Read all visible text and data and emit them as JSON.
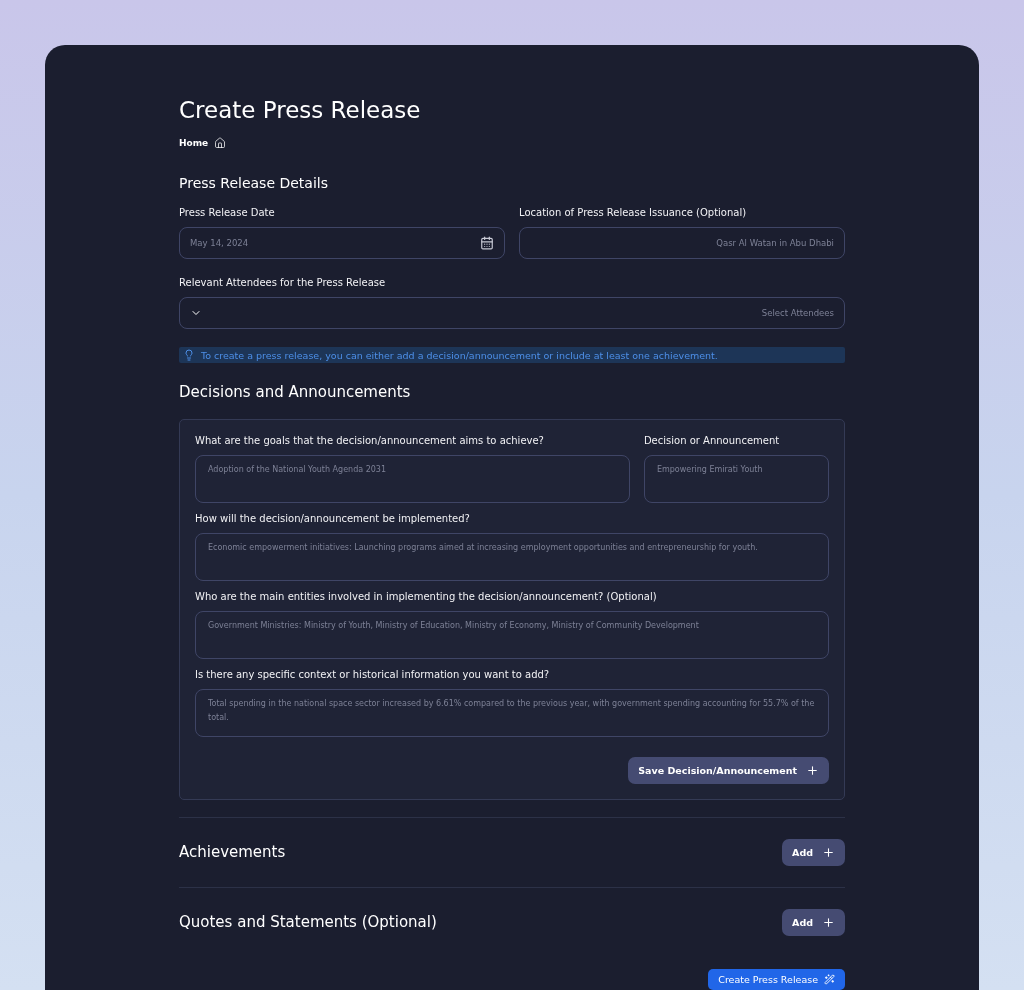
{
  "title": "Create Press Release",
  "breadcrumb": {
    "label": "Home"
  },
  "details": {
    "heading": "Press Release Details",
    "fields": [
      {
        "label": "Press Release Date",
        "placeholder": "May 14, 2024",
        "kind": "date"
      },
      {
        "label": "Location of Press Release Issuance (Optional)",
        "placeholder": "Qasr Al Watan in Abu Dhabi",
        "kind": "text"
      }
    ],
    "attendees": {
      "label": "Relevant Attendees for the Press Release",
      "placeholder": "Select Attendees"
    },
    "notice": "To create a press release, you can either add a decision/announcement or include at least one achievement."
  },
  "decisions": {
    "heading": "Decisions and Announcements",
    "top_fields": [
      {
        "label": "What are the goals that the decision/announcement aims to achieve?",
        "placeholder": "Adoption of the National Youth Agenda 2031"
      },
      {
        "label": "Decision or Announcement",
        "placeholder": "Empowering Emirati Youth"
      }
    ],
    "fields": [
      {
        "label": "How will the decision/announcement be implemented?",
        "placeholder": "Economic empowerment initiatives: Launching programs aimed at increasing employment opportunities and entrepreneurship for youth."
      },
      {
        "label": "Who are the main entities involved in implementing the decision/announcement? (Optional)",
        "placeholder": "Government Ministries: Ministry of Youth, Ministry of Education, Ministry of Economy, Ministry of Community Development"
      },
      {
        "label": "Is there any specific context or historical information you want to add?",
        "placeholder": "Total spending in the national space sector increased by 6.61% compared to the previous year, with government spending accounting for 55.7% of the total."
      }
    ],
    "save_button": "Save Decision/Announcement"
  },
  "sections": [
    {
      "heading": "Achievements",
      "button": "Add"
    },
    {
      "heading": "Quotes and Statements (Optional)",
      "button": "Add"
    }
  ],
  "submit_button": "Create Press Release"
}
